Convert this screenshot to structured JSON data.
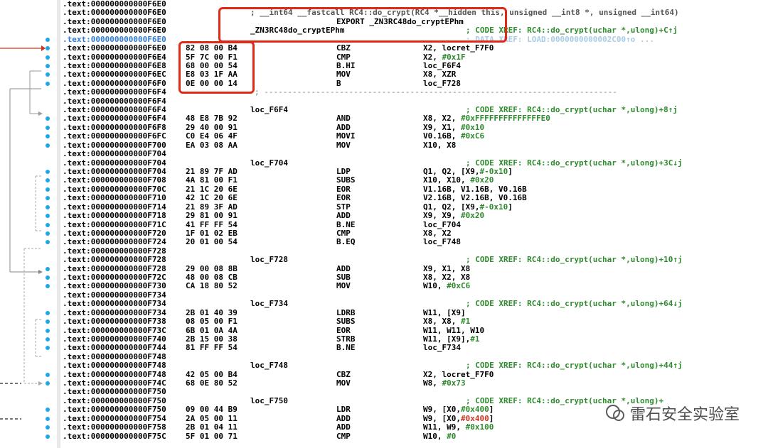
{
  "prototype": "; __int64 __fastcall RC4::do_crypt(RC4 *__hidden this, unsigned __int8 *, unsigned __int64)",
  "export": "EXPORT _ZN3RC48do_cryptEPhm",
  "func_label": "_ZN3RC48do_cryptEPhm",
  "func_xref": "; CODE XREF: RC4::do_crypt(uchar *,ulong)+C↑j",
  "data_xref": "; DATA XREF: LOAD:0000000000002C00↑o ...",
  "separator": "; ---------------------------------------------------------------------------",
  "watermark": "雷石安全实验室",
  "lines": [
    {
      "addr": ".text:000000000000F6E0"
    },
    {
      "addr": ".text:000000000000F6E0",
      "kind": "proto"
    },
    {
      "addr": ".text:000000000000F6E0",
      "kind": "export"
    },
    {
      "addr": ".text:000000000000F6E0",
      "label": "_ZN3RC48do_cryptEPhm",
      "cm": "; CODE XREF: RC4::do_crypt(uchar *,ulong)+C↑j"
    },
    {
      "addr": ".text:000000000000F6E0",
      "hl": true,
      "cm": "; DATA XREF: LOAD:0000000000002C00↑o ..."
    },
    {
      "addr": ".text:000000000000F6E0",
      "bytes": "82 08 00 B4",
      "mn": "CBZ",
      "op": "X2, locret_F7F0"
    },
    {
      "addr": ".text:000000000000F6E4",
      "bytes": "5F 7C 00 F1",
      "mn": "CMP",
      "op": "X2, #0x1F"
    },
    {
      "addr": ".text:000000000000F6E8",
      "bytes": "68 00 00 54",
      "mn": "B.HI",
      "op": "loc_F6F4"
    },
    {
      "addr": ".text:000000000000F6EC",
      "bytes": "E8 03 1F AA",
      "mn": "MOV",
      "op": "X8, XZR"
    },
    {
      "addr": ".text:000000000000F6F0",
      "bytes": "0E 00 00 14",
      "mn": "B",
      "op": "loc_F728"
    },
    {
      "addr": ".text:000000000000F6F4",
      "kind": "sep"
    },
    {
      "addr": ".text:000000000000F6F4"
    },
    {
      "addr": ".text:000000000000F6F4",
      "label": "loc_F6F4",
      "cm": "; CODE XREF: RC4::do_crypt(uchar *,ulong)+8↑j"
    },
    {
      "addr": ".text:000000000000F6F4",
      "bytes": "48 E8 7B 92",
      "mn": "AND",
      "op": "X8, X2, #0xFFFFFFFFFFFFFFE0"
    },
    {
      "addr": ".text:000000000000F6F8",
      "bytes": "29 40 00 91",
      "mn": "ADD",
      "op": "X9, X1, #0x10"
    },
    {
      "addr": ".text:000000000000F6FC",
      "bytes": "C0 E4 06 4F",
      "mn": "MOVI",
      "op": "V0.16B, #0xC6"
    },
    {
      "addr": ".text:000000000000F700",
      "bytes": "EA 03 08 AA",
      "mn": "MOV",
      "op": "X10, X8"
    },
    {
      "addr": ".text:000000000000F704"
    },
    {
      "addr": ".text:000000000000F704",
      "label": "loc_F704",
      "cm": "; CODE XREF: RC4::do_crypt(uchar *,ulong)+3C↓j"
    },
    {
      "addr": ".text:000000000000F704",
      "bytes": "21 89 7F AD",
      "mn": "LDP",
      "op": "Q1, Q2, [X9,#-0x10]"
    },
    {
      "addr": ".text:000000000000F708",
      "bytes": "4A 81 00 F1",
      "mn": "SUBS",
      "op": "X10, X10, #0x20"
    },
    {
      "addr": ".text:000000000000F70C",
      "bytes": "21 1C 20 6E",
      "mn": "EOR",
      "op": "V1.16B, V1.16B, V0.16B"
    },
    {
      "addr": ".text:000000000000F710",
      "bytes": "42 1C 20 6E",
      "mn": "EOR",
      "op": "V2.16B, V2.16B, V0.16B"
    },
    {
      "addr": ".text:000000000000F714",
      "bytes": "21 89 3F AD",
      "mn": "STP",
      "op": "Q1, Q2, [X9,#-0x10]"
    },
    {
      "addr": ".text:000000000000F718",
      "bytes": "29 81 00 91",
      "mn": "ADD",
      "op": "X9, X9, #0x20"
    },
    {
      "addr": ".text:000000000000F71C",
      "bytes": "41 FF FF 54",
      "mn": "B.NE",
      "op": "loc_F704"
    },
    {
      "addr": ".text:000000000000F720",
      "bytes": "1F 01 02 EB",
      "mn": "CMP",
      "op": "X8, X2"
    },
    {
      "addr": ".text:000000000000F724",
      "bytes": "20 01 00 54",
      "mn": "B.EQ",
      "op": "loc_F748"
    },
    {
      "addr": ".text:000000000000F728"
    },
    {
      "addr": ".text:000000000000F728",
      "label": "loc_F728",
      "cm": "; CODE XREF: RC4::do_crypt(uchar *,ulong)+10↑j"
    },
    {
      "addr": ".text:000000000000F728",
      "bytes": "29 00 08 8B",
      "mn": "ADD",
      "op": "X9, X1, X8"
    },
    {
      "addr": ".text:000000000000F72C",
      "bytes": "48 00 08 CB",
      "mn": "SUB",
      "op": "X8, X2, X8"
    },
    {
      "addr": ".text:000000000000F730",
      "bytes": "CA 18 80 52",
      "mn": "MOV",
      "op": "W10, #0xC6"
    },
    {
      "addr": ".text:000000000000F734"
    },
    {
      "addr": ".text:000000000000F734",
      "label": "loc_F734",
      "cm": "; CODE XREF: RC4::do_crypt(uchar *,ulong)+64↓j"
    },
    {
      "addr": ".text:000000000000F734",
      "bytes": "2B 01 40 39",
      "mn": "LDRB",
      "op": "W11, [X9]"
    },
    {
      "addr": ".text:000000000000F738",
      "bytes": "08 05 00 F1",
      "mn": "SUBS",
      "op": "X8, X8, #1"
    },
    {
      "addr": ".text:000000000000F73C",
      "bytes": "6B 01 0A 4A",
      "mn": "EOR",
      "op": "W11, W11, W10"
    },
    {
      "addr": ".text:000000000000F740",
      "bytes": "2B 15 00 38",
      "mn": "STRB",
      "op": "W11, [X9],#1"
    },
    {
      "addr": ".text:000000000000F744",
      "bytes": "81 FF FF 54",
      "mn": "B.NE",
      "op": "loc_F734"
    },
    {
      "addr": ".text:000000000000F748"
    },
    {
      "addr": ".text:000000000000F748",
      "label": "loc_F748",
      "cm": "; CODE XREF: RC4::do_crypt(uchar *,ulong)+44↑j"
    },
    {
      "addr": ".text:000000000000F748",
      "bytes": "42 05 00 B4",
      "mn": "CBZ",
      "op": "X2, locret_F7F0"
    },
    {
      "addr": ".text:000000000000F74C",
      "bytes": "68 0E 80 52",
      "mn": "MOV",
      "op": "W8, #0x73"
    },
    {
      "addr": ".text:000000000000F750"
    },
    {
      "addr": ".text:000000000000F750",
      "label": "loc_F750",
      "cm": "; CODE XREF: RC4::do_crypt(uchar *,ulong)+"
    },
    {
      "addr": ".text:000000000000F750",
      "bytes": "09 00 44 B9",
      "mn": "LDR",
      "op": "W9, [X0,#0x400]"
    },
    {
      "addr": ".text:000000000000F754",
      "bytes": "2A 05 00 11",
      "mn": "ADD",
      "op": "W10, W9, #1"
    },
    {
      "addr": ".text:000000000000F758",
      "bytes": "2B 01 04 11",
      "mn": "ADD",
      "op": "W11, W9, #0x100"
    },
    {
      "addr": ".text:000000000000F75C",
      "bytes": "5F 01 00 71",
      "mn": "CMP",
      "op": "W10, #0"
    }
  ]
}
